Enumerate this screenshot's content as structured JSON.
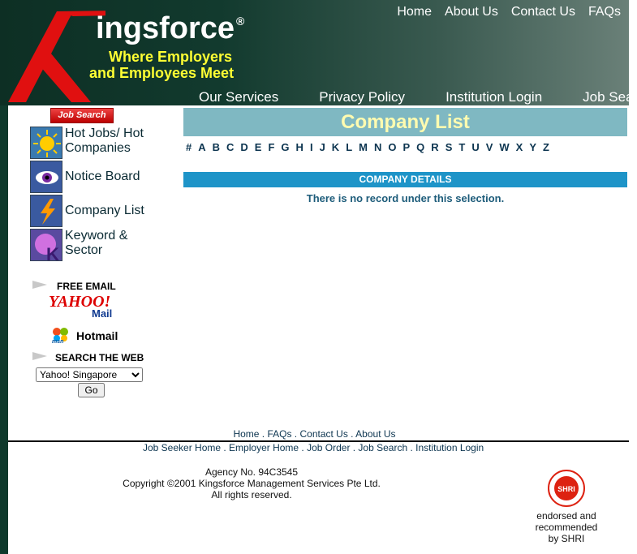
{
  "header": {
    "brand": "ingsforce",
    "registered": "®",
    "tagline_line1": "Where Employers",
    "tagline_line2": "and Employees Meet",
    "top_nav": [
      "Home",
      "About Us",
      "Contact Us",
      "FAQs"
    ],
    "main_nav": [
      "Our Services",
      "Privacy Policy",
      "Institution Login",
      "Job Search"
    ]
  },
  "sidebar": {
    "badge": "Job Search",
    "items": [
      {
        "label": "Hot Jobs/ Hot Companies",
        "icon": "sun-icon"
      },
      {
        "label": "Notice Board",
        "icon": "eye-icon"
      },
      {
        "label": "Company List",
        "icon": "lightning-icon"
      },
      {
        "label": "Keyword & Sector",
        "icon": "k-letter-icon"
      }
    ],
    "free_email": "FREE EMAIL",
    "yahoo_text": "YAHOO!",
    "yahoo_mail": "Mail",
    "msn": "msn",
    "hotmail": "Hotmail",
    "search_web": "SEARCH THE WEB",
    "search_select": "Yahoo! Singapore",
    "go": "Go"
  },
  "main": {
    "title": "Company List",
    "letters": [
      "#",
      "A",
      "B",
      "C",
      "D",
      "E",
      "F",
      "G",
      "H",
      "I",
      "J",
      "K",
      "L",
      "M",
      "N",
      "O",
      "P",
      "Q",
      "R",
      "S",
      "T",
      "U",
      "V",
      "W",
      "X",
      "Y",
      "Z"
    ],
    "details_header": "COMPANY DETAILS",
    "no_record": "There is no record under this selection."
  },
  "footer": {
    "nav1": "Home . FAQs . Contact Us . About Us",
    "nav2": "Job Seeker Home . Employer Home . Job Order . Job Search . Institution Login",
    "agency": "Agency No. 94C3545",
    "copyright": "Copyright ©2001 Kingsforce Management Services Pte Ltd.",
    "rights": "All rights reserved.",
    "shri_seal": "SHRI",
    "shri_text": "endorsed and recommended by SHRI"
  },
  "colors": {
    "header_dark": "#0d2f24",
    "title_bar": "#7fb8c2",
    "title_text": "#fffbb0",
    "details_bar": "#1e94c8",
    "k_red": "#e01010",
    "tagline": "#ffff33"
  }
}
